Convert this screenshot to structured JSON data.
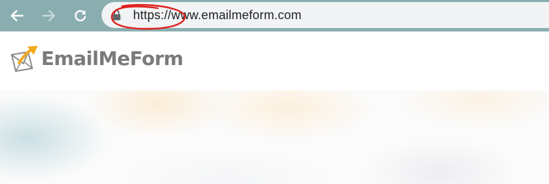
{
  "browser": {
    "url_text": "https://www.emailmeform.com",
    "nav": {
      "back_icon": "arrow-left-icon",
      "forward_icon": "arrow-right-icon",
      "reload_icon": "reload-icon"
    },
    "secure_icon": "lock-icon",
    "toolbar_color": "#8aaeb0",
    "annotation_color": "#e0201c"
  },
  "site": {
    "logo_text": "EmailMeForm",
    "logo_icon": "envelope-arrow-icon",
    "colors": {
      "logo_text": "#7a7a7a",
      "logo_arrow": "#f2a81d"
    }
  }
}
